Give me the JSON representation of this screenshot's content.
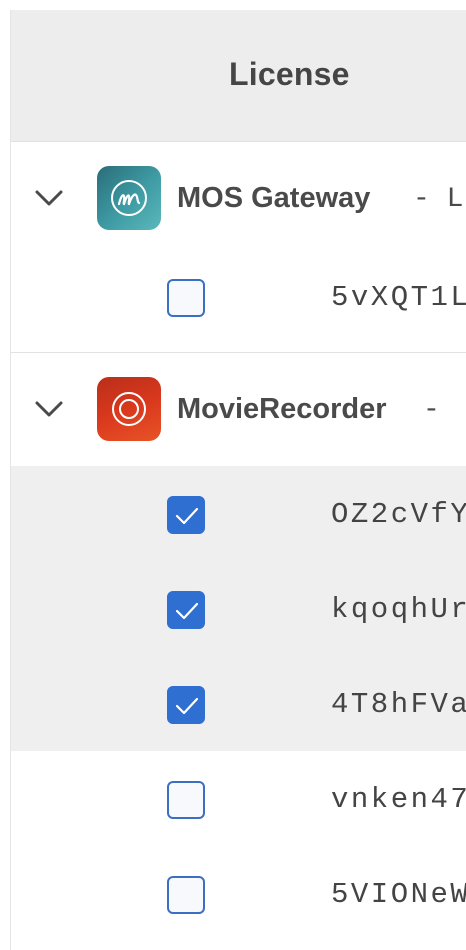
{
  "header": {
    "title": "License"
  },
  "groups": [
    {
      "app_name": "MOS Gateway",
      "separator": "-  L",
      "icon": "mos-gateway-icon",
      "expanded": true,
      "licenses": [
        {
          "key": "5vXQT1L",
          "checked": false
        }
      ]
    },
    {
      "app_name": "MovieRecorder",
      "separator": "-",
      "icon": "movie-recorder-icon",
      "expanded": true,
      "licenses": [
        {
          "key": "OZ2cVfY",
          "checked": true
        },
        {
          "key": "kqoqhUr",
          "checked": true
        },
        {
          "key": "4T8hFVa",
          "checked": true
        },
        {
          "key": "vnken47",
          "checked": false
        },
        {
          "key": "5VIONeW",
          "checked": false
        }
      ]
    }
  ],
  "colors": {
    "checkbox_checked": "#2f6fd1",
    "checkbox_border": "#3a6fc4",
    "header_bg": "#ededed",
    "selected_row_bg": "#efefef",
    "mos_icon": "#3f9ca5",
    "movie_icon": "#d9381d"
  }
}
